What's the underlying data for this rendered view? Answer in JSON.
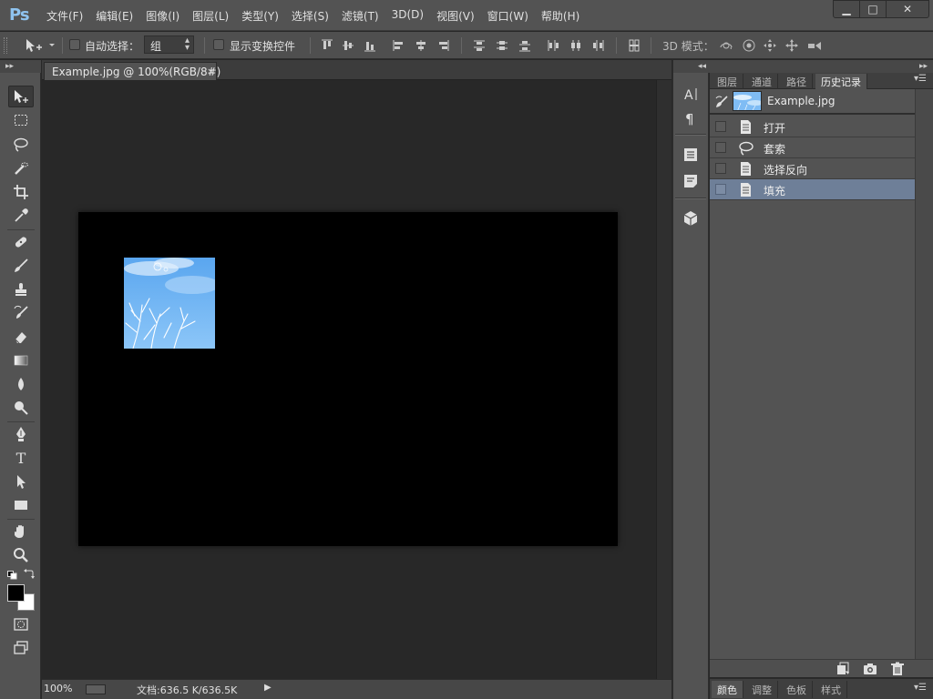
{
  "app": {
    "logo": "Ps",
    "menu": [
      "文件(F)",
      "编辑(E)",
      "图像(I)",
      "图层(L)",
      "类型(Y)",
      "选择(S)",
      "滤镜(T)",
      "3D(D)",
      "视图(V)",
      "窗口(W)",
      "帮助(H)"
    ],
    "window_buttons": {
      "minimize": "▁",
      "maximize": "□",
      "close": "✕"
    }
  },
  "options_bar": {
    "auto_select_label": "自动选择：",
    "auto_select_target": "组",
    "show_transform_label": "显示变换控件",
    "mode_3d_label": "3D 模式："
  },
  "document": {
    "tab_title": "Example.jpg @ 100%(RGB/8#)",
    "tab_close": "×",
    "colors": {
      "canvas": "#000000",
      "image_sky": "#6fb4f2"
    }
  },
  "status": {
    "zoom": "100%",
    "doc_size": "文档:636.5 K/636.5K",
    "menu_arrow": "▶"
  },
  "history_panel": {
    "tabs": [
      "图层",
      "通道",
      "路径",
      "历史记录"
    ],
    "active_tab": "历史记录",
    "snapshot_name": "Example.jpg",
    "states": [
      {
        "label": "打开",
        "icon": "document-icon"
      },
      {
        "label": "套索",
        "icon": "lasso-icon"
      },
      {
        "label": "选择反向",
        "icon": "document-icon"
      },
      {
        "label": "填充",
        "icon": "document-icon"
      }
    ],
    "selected_state": "填充"
  },
  "bottom_panel": {
    "tabs": [
      "颜色",
      "调整",
      "色板",
      "样式"
    ],
    "active_tab": "颜色"
  }
}
